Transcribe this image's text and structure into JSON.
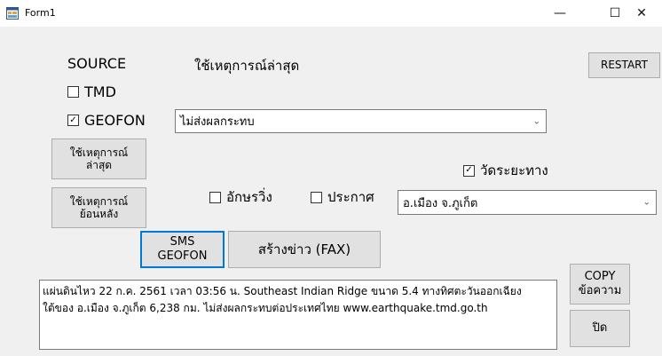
{
  "window": {
    "title": "Form1",
    "controls": {
      "minimize": "—",
      "maximize": "☐",
      "close": "✕"
    }
  },
  "source": {
    "label": "SOURCE",
    "status": "ใช้เหตุการณ์ล่าสุด",
    "restart_label": "RESTART"
  },
  "checkboxes": {
    "tmd": {
      "label": "TMD",
      "checked": false
    },
    "geofon": {
      "label": "GEOFON",
      "checked": true
    },
    "measure_distance": {
      "label": "วัดระยะทาง",
      "checked": true
    },
    "akshara_wing": {
      "label": "อักษรวิ่ง",
      "checked": false
    },
    "prakat": {
      "label": "ประกาศ",
      "checked": false
    }
  },
  "impact_select": {
    "value": "ไม่ส่งผลกระทบ"
  },
  "location_select": {
    "value": "อ.เมือง จ.ภูเก็ต"
  },
  "buttons": {
    "latest_event": {
      "line1": "ใช้เหตุการณ์",
      "line2": "ล่าสุด"
    },
    "past_event": {
      "line1": "ใช้เหตุการณ์",
      "line2": "ย้อนหลัง"
    },
    "sms_geofon": {
      "line1": "SMS",
      "line2": "GEOFON"
    },
    "create_news": {
      "label": "สร้างข่าว (FAX)"
    },
    "copy_message": {
      "line1": "COPY",
      "line2": "ข้อความ"
    },
    "close": {
      "label": "ปิด"
    }
  },
  "message": {
    "line1": "แผ่นดินไหว 22 ก.ค. 2561 เวลา 03:56 น. Southeast Indian Ridge ขนาด 5.4 ทางทิศตะวันออกเฉียง",
    "line2": "ใต้ของ อ.เมือง จ.ภูเก็ต 6,238 กม. ไม่ส่งผลกระทบต่อประเทศไทย www.earthquake.tmd.go.th"
  },
  "colors": {
    "focus_border": "#0078d7",
    "window_bg": "#f0f0f0"
  }
}
